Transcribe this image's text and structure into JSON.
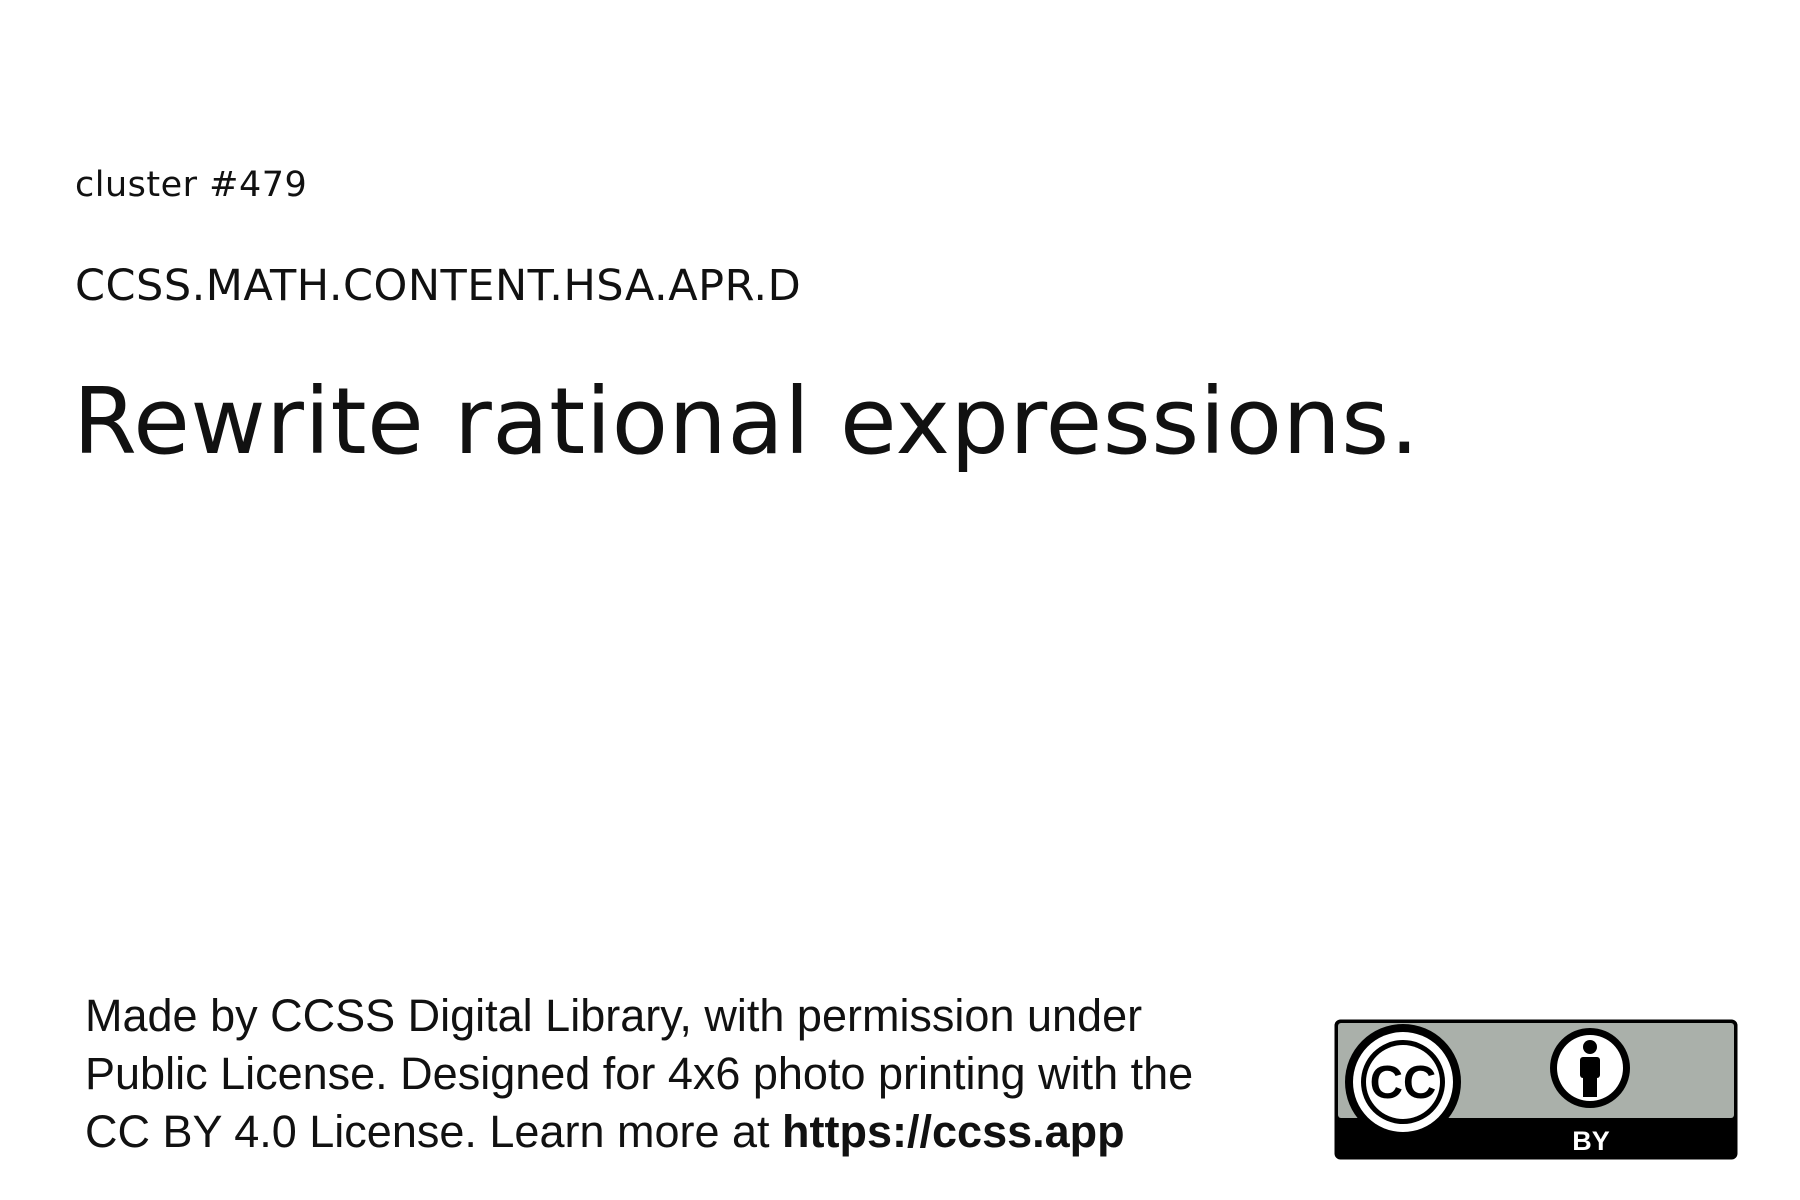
{
  "card": {
    "cluster_label": "cluster #479",
    "standard_code": "CCSS.MATH.CONTENT.HSA.APR.D",
    "headline": "Rewrite rational expressions."
  },
  "footer": {
    "line1": "Made by CCSS Digital Library, with permission under",
    "line2": "Public License. Designed for 4x6 photo printing with the",
    "line3_prefix": "CC BY 4.0 License. Learn more at ",
    "link_text": "https://ccss.app"
  },
  "license_badge": {
    "icon": "cc-by-license-icon",
    "cc_text": "CC",
    "by_text": "BY",
    "colors": {
      "gray_band": "#aab0aa",
      "black": "#000000",
      "white": "#ffffff"
    }
  }
}
